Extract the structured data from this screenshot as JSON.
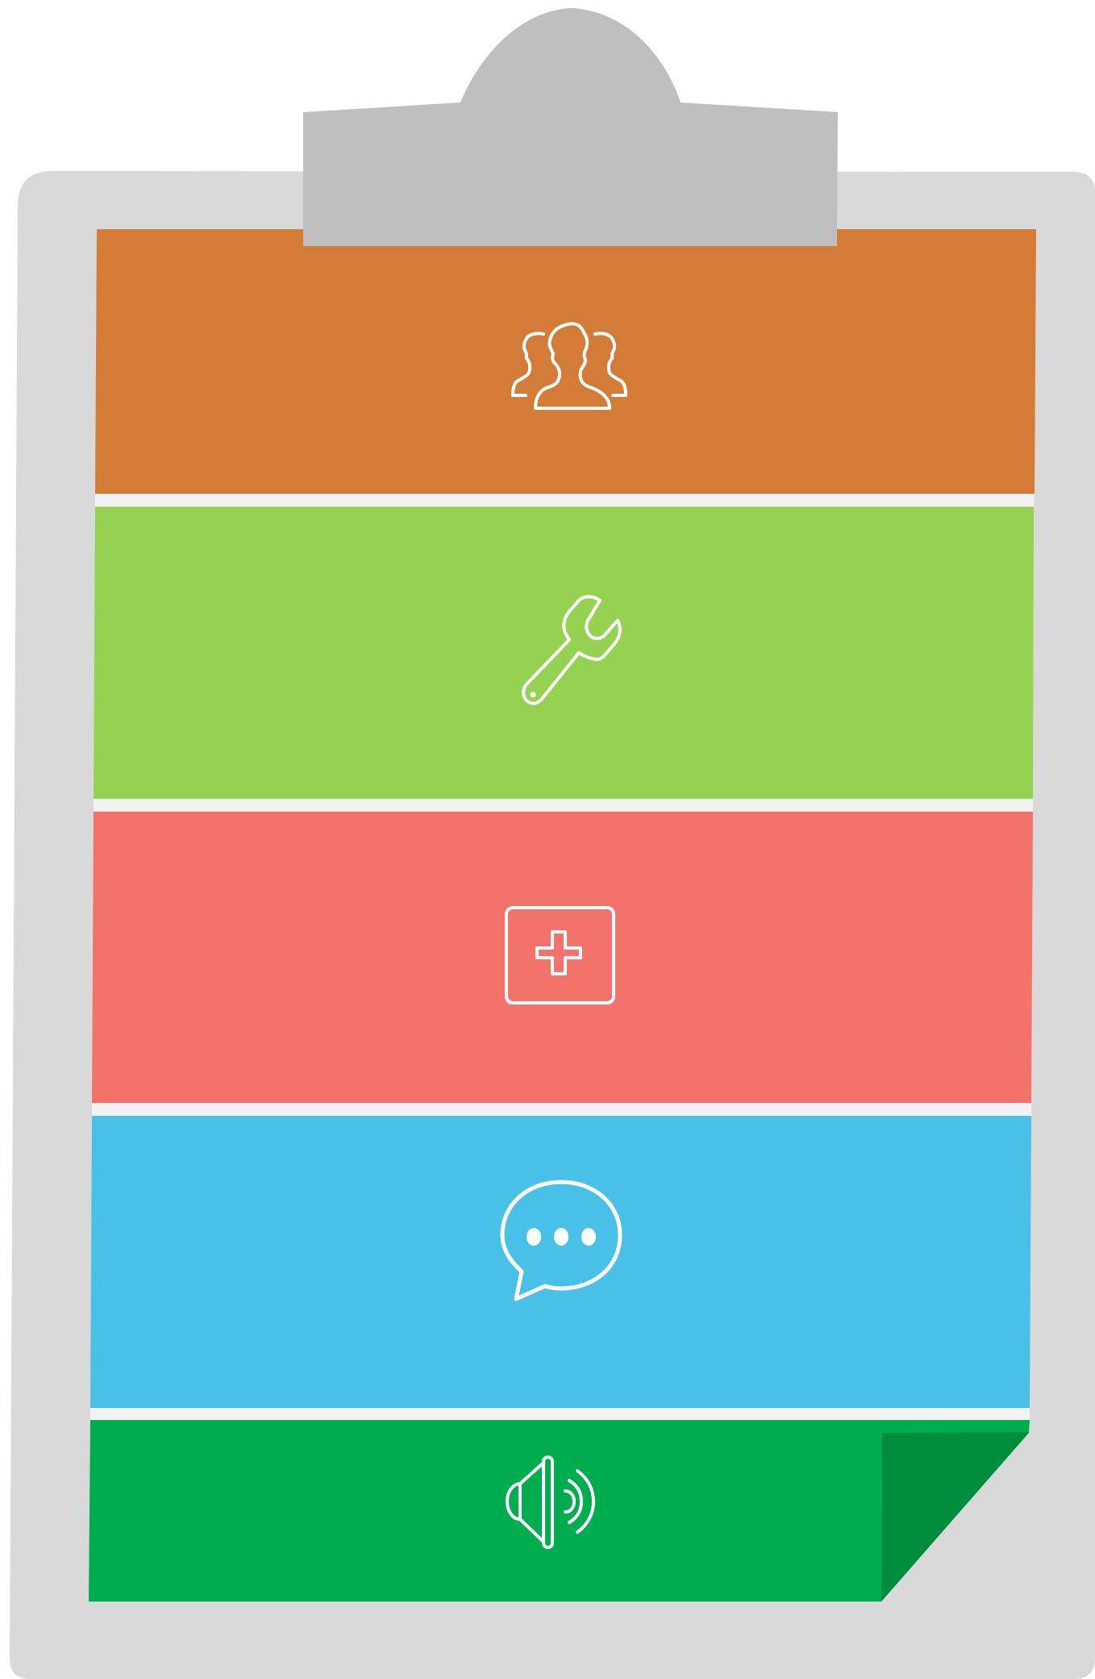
{
  "colors": {
    "board": "#d9d9d9",
    "clip": "#bfbfbf",
    "separator": "#f2f2f2",
    "icon_stroke": "#ffffff",
    "fold": "#008c3f"
  },
  "sections": [
    {
      "id": "team",
      "icon": "users-icon",
      "color": "#d37c37"
    },
    {
      "id": "tools",
      "icon": "wrench-icon",
      "color": "#95d251"
    },
    {
      "id": "medical",
      "icon": "first-aid-icon",
      "color": "#f3736b"
    },
    {
      "id": "chat",
      "icon": "chat-bubble-icon",
      "color": "#48c0e8"
    },
    {
      "id": "audio",
      "icon": "speaker-icon",
      "color": "#00ad4e"
    }
  ]
}
